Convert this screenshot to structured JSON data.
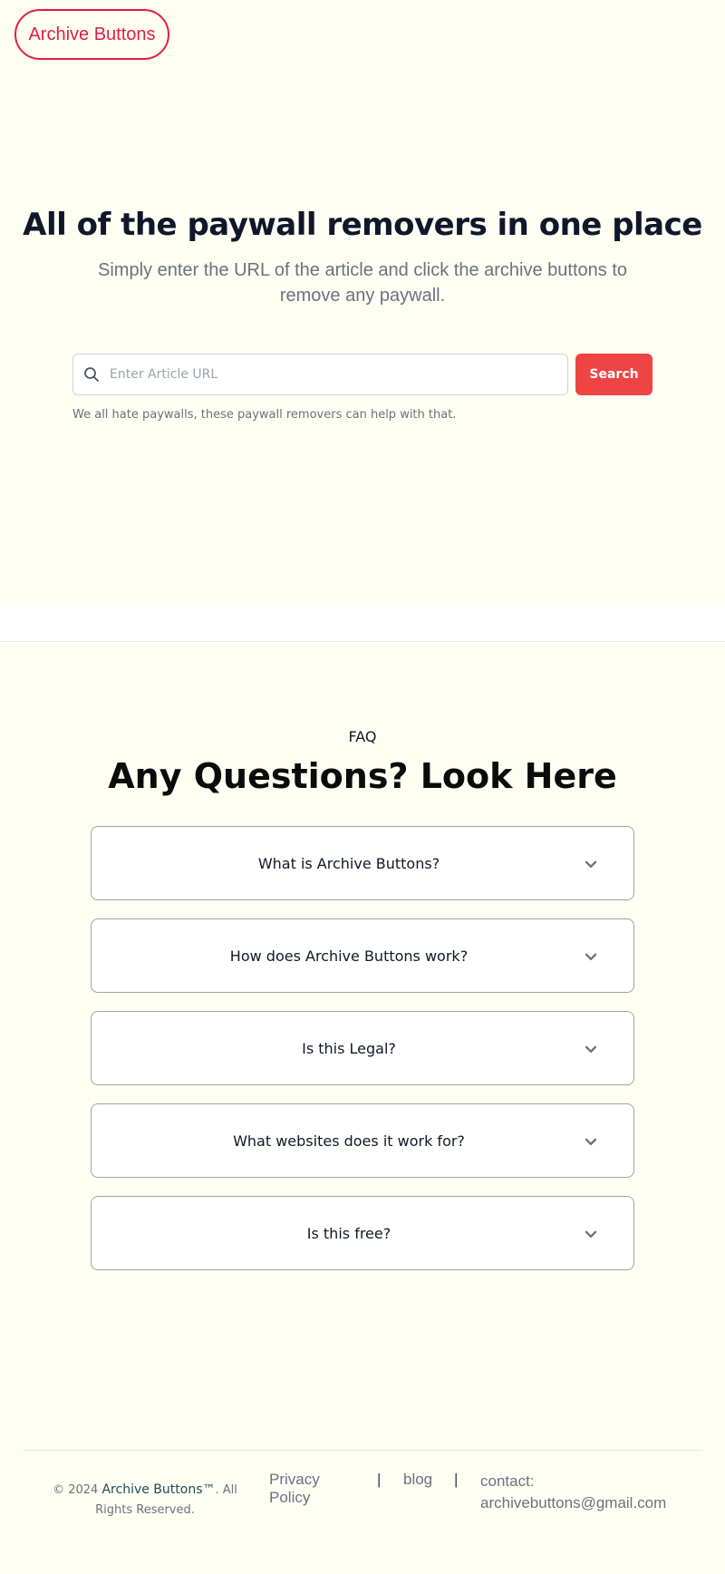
{
  "header": {
    "logo_label": "Archive Buttons"
  },
  "hero": {
    "title": "All of the paywall removers in one place",
    "subtitle": "Simply enter the URL of the article and click the archive buttons to remove any paywall.",
    "search": {
      "placeholder": "Enter Article URL",
      "value": "",
      "button_label": "Search",
      "icon": "search-icon"
    },
    "note": "We all hate paywalls, these paywall removers can help with that."
  },
  "faq": {
    "label": "FAQ",
    "title": "Any Questions? Look Here",
    "items": [
      {
        "question": "What is Archive Buttons?"
      },
      {
        "question": "How does Archive Buttons work?"
      },
      {
        "question": "Is this Legal?"
      },
      {
        "question": "What websites does it work for?"
      },
      {
        "question": "Is this free?"
      }
    ]
  },
  "footer": {
    "copyright_prefix": "© 2024",
    "brand": "Archive Buttons™",
    "copyright_suffix": ". All Rights Reserved.",
    "links": {
      "privacy": "Privacy Policy",
      "separator": "|",
      "blog": "blog"
    },
    "contact": "contact: archivebuttons@gmail.com"
  },
  "colors": {
    "page_background": "#fefef2",
    "accent_red": "#ef4444",
    "logo_red": "#e11d48"
  }
}
